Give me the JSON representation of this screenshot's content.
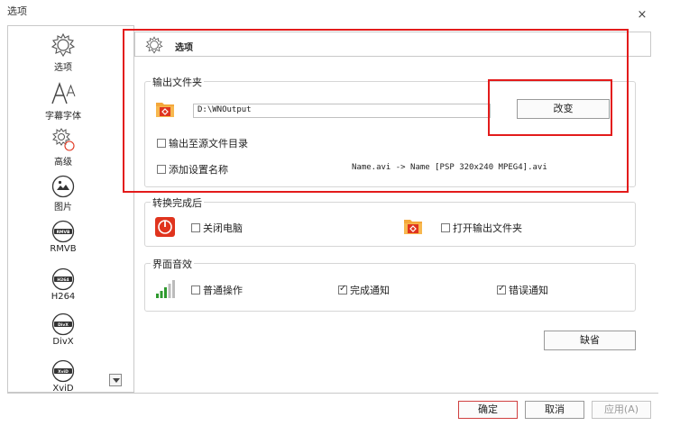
{
  "window": {
    "title": "选项",
    "close_label": "×"
  },
  "sidebar": {
    "items": [
      {
        "label": "选项",
        "icon": "gear-icon"
      },
      {
        "label": "字幕字体",
        "icon": "font-icon"
      },
      {
        "label": "高级",
        "icon": "advanced-gear-icon"
      },
      {
        "label": "图片",
        "icon": "image-icon"
      },
      {
        "label": "RMVB",
        "icon": "rmvb-icon"
      },
      {
        "label": "H264",
        "icon": "h264-icon"
      },
      {
        "label": "DivX",
        "icon": "divx-icon"
      },
      {
        "label": "XviD",
        "icon": "xvid-icon"
      }
    ],
    "badges": {
      "rmvb": "RMVB",
      "h264": "H264",
      "divx": "DivX",
      "xvid": "XviD"
    }
  },
  "header": {
    "title": "选项",
    "icon": "gear-icon"
  },
  "output_folder": {
    "group_title": "输出文件夹",
    "path": "D:\\WNOutput",
    "change_button": "改变",
    "output_to_source_label": "输出至源文件目录",
    "output_to_source_checked": false,
    "add_setting_name_label": "添加设置名称",
    "add_setting_name_checked": false,
    "rename_example": "Name.avi  -> Name [PSP 320x240 MPEG4].avi"
  },
  "after_conversion": {
    "group_title": "转换完成后",
    "shutdown_label": "关闭电脑",
    "shutdown_checked": false,
    "open_folder_label": "打开输出文件夹",
    "open_folder_checked": false
  },
  "sound": {
    "group_title": "界面音效",
    "normal_label": "普通操作",
    "normal_checked": false,
    "done_label": "完成通知",
    "done_checked": true,
    "error_label": "错误通知",
    "error_checked": true
  },
  "default_button": "缺省",
  "footer": {
    "ok": "确定",
    "cancel": "取消",
    "apply": "应用(A)"
  },
  "colors": {
    "highlight_red": "#e31b1b",
    "folder_orange": "#f4a73a",
    "icon_red": "#e0341e"
  }
}
